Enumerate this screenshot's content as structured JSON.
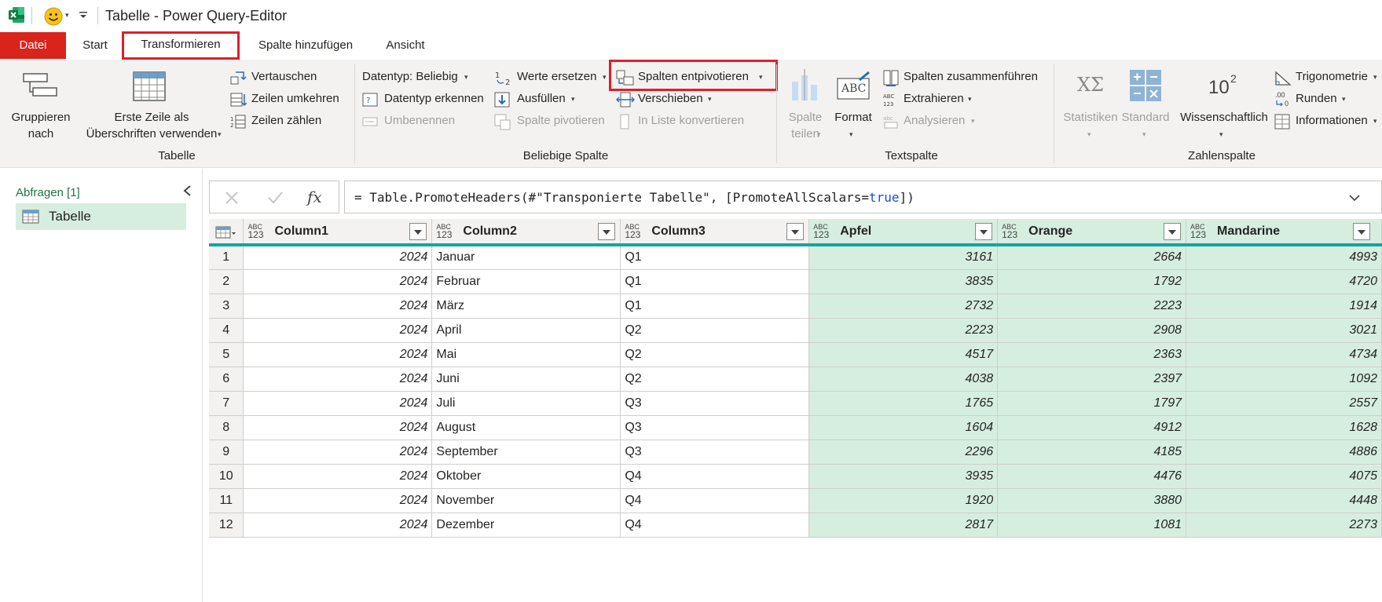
{
  "window": {
    "title": "Tabelle - Power Query-Editor"
  },
  "tabs": [
    {
      "label": "Datei"
    },
    {
      "label": "Start"
    },
    {
      "label": "Transformieren"
    },
    {
      "label": "Spalte hinzufügen"
    },
    {
      "label": "Ansicht"
    }
  ],
  "ribbon": {
    "tabelle": {
      "group_label": "Tabelle",
      "gruppieren_l1": "Gruppieren",
      "gruppieren_l2": "nach",
      "erste_zeile_l1": "Erste Zeile als",
      "erste_zeile_l2": "Überschriften verwenden",
      "vertauschen": "Vertauschen",
      "zeilen_umkehren": "Zeilen umkehren",
      "zeilen_zaehlen": "Zeilen zählen"
    },
    "beliebige_spalte": {
      "group_label": "Beliebige Spalte",
      "datentyp": "Datentyp: Beliebig",
      "datentyp_erkennen": "Datentyp erkennen",
      "umbenennen": "Umbenennen",
      "werte_ersetzen": "Werte ersetzen",
      "ausfuellen": "Ausfüllen",
      "spalte_pivotieren": "Spalte pivotieren",
      "spalten_entpivotieren": "Spalten entpivotieren",
      "verschieben": "Verschieben",
      "in_liste": "In Liste konvertieren"
    },
    "textspalte": {
      "group_label": "Textspalte",
      "spalte_l1": "Spalte",
      "spalte_l2": "teilen",
      "format": "Format",
      "abc_glyph": "ABC",
      "zusammenfuehren": "Spalten zusammenführen",
      "extrahieren": "Extrahieren",
      "analysieren": "Analysieren"
    },
    "zahlenspalte": {
      "group_label": "Zahlenspalte",
      "statistiken": "Statistiken",
      "standard": "Standard",
      "wissenschaftlich": "Wissenschaftlich",
      "trigonometrie": "Trigonometrie",
      "runden": "Runden",
      "informationen": "Informationen",
      "stat_glyph": "XΣ",
      "sci_base": "10",
      "sci_exp": "2",
      "round_glyph_top": ".00",
      "round_glyph_bottom": "0"
    }
  },
  "queries": {
    "header": "Abfragen [1]",
    "items": [
      {
        "label": "Tabelle"
      }
    ]
  },
  "formula": {
    "fx": "fx",
    "prefix": "= Table.PromoteHeaders(#\"Transponierte Tabelle\", [PromoteAllScalars=",
    "keyword": "true",
    "suffix": "])"
  },
  "table": {
    "type_top": "ABC",
    "type_bottom": "123",
    "columns": [
      "Column1",
      "Column2",
      "Column3",
      "Apfel",
      "Orange",
      "Mandarine"
    ],
    "rows": [
      [
        "1",
        "2024",
        "Januar",
        "Q1",
        "3161",
        "2664",
        "4993"
      ],
      [
        "2",
        "2024",
        "Februar",
        "Q1",
        "3835",
        "1792",
        "4720"
      ],
      [
        "3",
        "2024",
        "März",
        "Q1",
        "2732",
        "2223",
        "1914"
      ],
      [
        "4",
        "2024",
        "April",
        "Q2",
        "2223",
        "2908",
        "3021"
      ],
      [
        "5",
        "2024",
        "Mai",
        "Q2",
        "4517",
        "2363",
        "4734"
      ],
      [
        "6",
        "2024",
        "Juni",
        "Q2",
        "4038",
        "2397",
        "1092"
      ],
      [
        "7",
        "2024",
        "Juli",
        "Q3",
        "1765",
        "1797",
        "2557"
      ],
      [
        "8",
        "2024",
        "August",
        "Q3",
        "1604",
        "4912",
        "1628"
      ],
      [
        "9",
        "2024",
        "September",
        "Q3",
        "2296",
        "4185",
        "4886"
      ],
      [
        "10",
        "2024",
        "Oktober",
        "Q4",
        "3935",
        "4476",
        "4075"
      ],
      [
        "11",
        "2024",
        "November",
        "Q4",
        "1920",
        "3880",
        "4448"
      ],
      [
        "12",
        "2024",
        "Dezember",
        "Q4",
        "2817",
        "1081",
        "2273"
      ]
    ]
  },
  "colors": {
    "accent_red": "#e01e28",
    "file_tab": "#d9241c",
    "selection_green": "#d6eee0",
    "header_underline": "#11a5a2",
    "excel_green": "#217346"
  }
}
